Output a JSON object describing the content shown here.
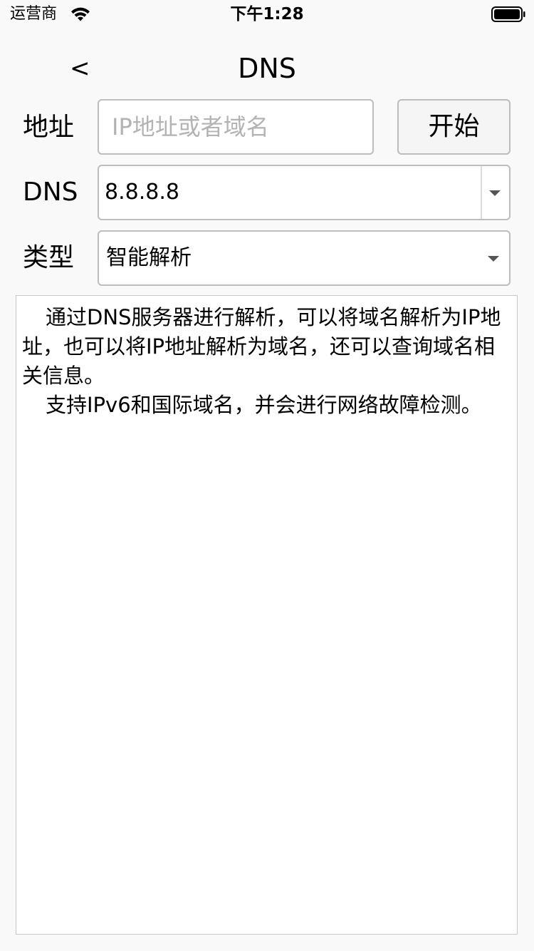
{
  "status_bar": {
    "carrier": "运营商",
    "time": "下午1:28"
  },
  "nav": {
    "back_label": "<",
    "title": "DNS"
  },
  "form": {
    "address_label": "地址",
    "address_value": "",
    "address_placeholder": "IP地址或者域名",
    "start_button_label": "开始",
    "dns_label": "DNS",
    "dns_value": "8.8.8.8",
    "type_label": "类型",
    "type_value": "智能解析"
  },
  "info": {
    "paragraphs": [
      "通过DNS服务器进行解析，可以将域名解析为IP地址，也可以将IP地址解析为域名，还可以查询域名相关信息。",
      "支持IPv6和国际域名，并会进行网络故障检测。"
    ]
  },
  "icons": {
    "wifi": "wifi-icon",
    "battery": "battery-icon",
    "dropdown": "caret-down-icon"
  }
}
